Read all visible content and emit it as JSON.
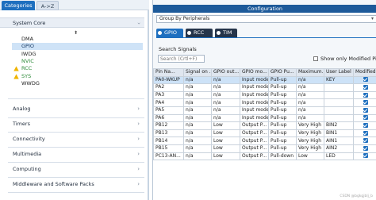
{
  "left": {
    "tabs": {
      "categories": "Categories",
      "az": "A->Z"
    },
    "groups": {
      "system_core": "System Core",
      "analog": "Analog",
      "timers": "Timers",
      "connectivity": "Connectivity",
      "multimedia": "Multimedia",
      "computing": "Computing",
      "middleware": "Middleware and Software Packs"
    },
    "sort_icon": "⬍",
    "items": [
      {
        "label": "DMA",
        "selected": false,
        "color": "normal",
        "warning": false
      },
      {
        "label": "GPIO",
        "selected": true,
        "color": "normal",
        "warning": false
      },
      {
        "label": "IWDG",
        "selected": false,
        "color": "normal",
        "warning": false
      },
      {
        "label": "NVIC",
        "selected": false,
        "color": "green",
        "warning": false
      },
      {
        "label": "RCC",
        "selected": false,
        "color": "green",
        "warning": true
      },
      {
        "label": "SYS",
        "selected": false,
        "color": "green",
        "warning": true
      },
      {
        "label": "WWDG",
        "selected": false,
        "color": "normal",
        "warning": false
      }
    ]
  },
  "right": {
    "title": "Configuration",
    "group_by": "Group By Peripherals",
    "tabs": [
      "GPIO",
      "RCC",
      "TIM"
    ],
    "search_label": "Search Signals",
    "search_placeholder": "Search (Crtl+F)",
    "show_modified": "Show only Modified Pin",
    "columns": [
      "Pin Na...",
      "Signal on ...",
      "GPIO out...",
      "GPIO mo...",
      "GPIO Pu...",
      "Maximum...",
      "User Label",
      "Modified"
    ],
    "rows": [
      [
        "PA0-WKUP",
        "n/a",
        "n/a",
        "Input mode",
        "Pull-up",
        "n/a",
        "KEY",
        true
      ],
      [
        "PA2",
        "n/a",
        "n/a",
        "Input mode",
        "Pull-up",
        "n/a",
        "",
        true
      ],
      [
        "PA3",
        "n/a",
        "n/a",
        "Input mode",
        "Pull-up",
        "n/a",
        "",
        true
      ],
      [
        "PA4",
        "n/a",
        "n/a",
        "Input mode",
        "Pull-up",
        "n/a",
        "",
        true
      ],
      [
        "PA5",
        "n/a",
        "n/a",
        "Input mode",
        "Pull-up",
        "n/a",
        "",
        true
      ],
      [
        "PA6",
        "n/a",
        "n/a",
        "Input mode",
        "Pull-up",
        "n/a",
        "",
        true
      ],
      [
        "PB12",
        "n/a",
        "Low",
        "Output P...",
        "Pull-up",
        "Very High",
        "BIN2",
        true
      ],
      [
        "PB13",
        "n/a",
        "Low",
        "Output P...",
        "Pull-up",
        "Very High",
        "BIN1",
        true
      ],
      [
        "PB14",
        "n/a",
        "Low",
        "Output P...",
        "Pull-up",
        "Very High",
        "AIN1",
        true
      ],
      [
        "PB15",
        "n/a",
        "Low",
        "Output P...",
        "Pull-up",
        "Very High",
        "AIN2",
        true
      ],
      [
        "PC13-AN...",
        "n/a",
        "Low",
        "Output P...",
        "Pull-down",
        "Low",
        "LED",
        true
      ]
    ],
    "selected_row": 0
  },
  "watermark": "CSDN @bgkgjblj_b",
  "colors": {
    "accent": "#1e6fbf",
    "header_dark": "#1d5a9a",
    "green_item": "#2e8b3a",
    "warning": "#f0b400"
  }
}
